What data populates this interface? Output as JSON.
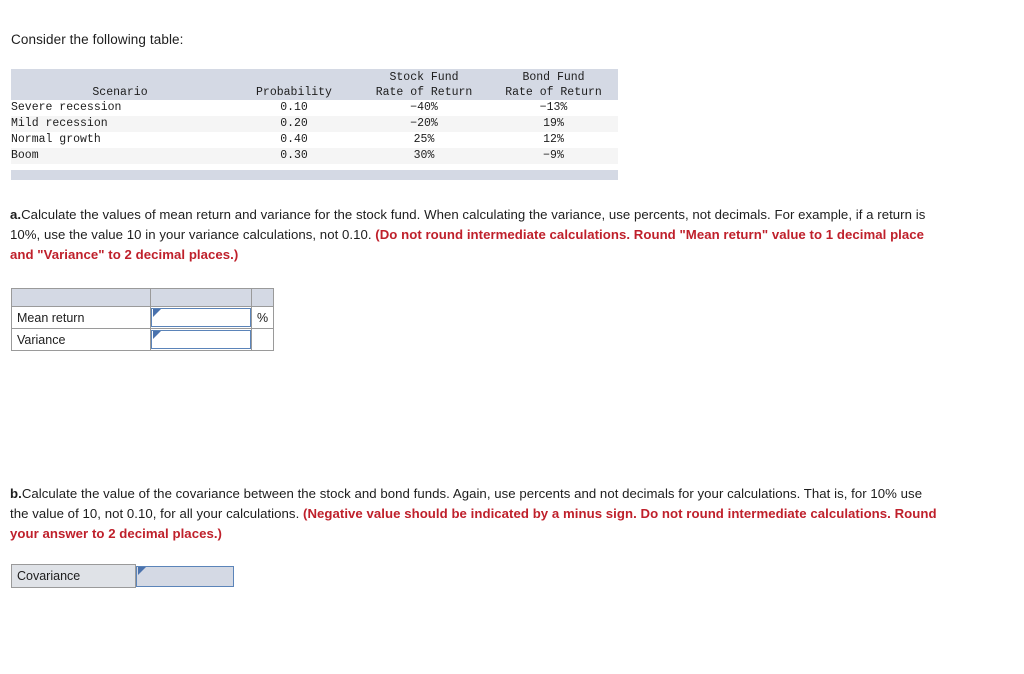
{
  "intro": "Consider the following table:",
  "scenario_table": {
    "headers": [
      {
        "line1": "",
        "line2": "Scenario"
      },
      {
        "line1": "",
        "line2": "Probability"
      },
      {
        "line1": "Stock Fund",
        "line2": "Rate of Return"
      },
      {
        "line1": "Bond Fund",
        "line2": "Rate of Return"
      }
    ],
    "rows": [
      {
        "scenario": "Severe recession",
        "probability": "0.10",
        "stock": "−40%",
        "bond": "−13%"
      },
      {
        "scenario": "Mild recession",
        "probability": "0.20",
        "stock": "−20%",
        "bond": "19%"
      },
      {
        "scenario": "Normal growth",
        "probability": "0.40",
        "stock": "25%",
        "bond": "12%"
      },
      {
        "scenario": "Boom",
        "probability": "0.30",
        "stock": "30%",
        "bond": "−9%"
      }
    ]
  },
  "question_a": {
    "label": "a.",
    "body": "Calculate the values of mean return and variance for the stock fund. When calculating the variance, use percents, not decimals.  For example, if a return is 10%, use the value 10 in your variance calculations, not 0.10. ",
    "emphasis": "(Do not round intermediate calculations. Round \"Mean return\" value to 1 decimal place and \"Variance\" to 2 decimal places.)"
  },
  "answer_a": {
    "rows": [
      {
        "label": "Mean return",
        "value": "",
        "placeholder": "",
        "unit": "%"
      },
      {
        "label": "Variance",
        "value": "",
        "placeholder": "",
        "unit": ""
      }
    ]
  },
  "question_b": {
    "label": "b.",
    "body": "Calculate the value of the covariance between the stock and bond funds.  Again, use percents and not decimals for your calculations.  That is, for 10% use the value of 10, not 0.10, for all your calculations. ",
    "emphasis": "(Negative value should be indicated by a minus sign. Do not round intermediate calculations. Round your answer to 2 decimal places.)"
  },
  "answer_b": {
    "label": "Covariance",
    "value": "",
    "placeholder": ""
  },
  "colors": {
    "header_fill": "#d4d9e4",
    "row_alt_fill": "#f5f5f5",
    "emphasis_red": "#bf202b",
    "field_border": "#5b84b9",
    "marker_blue": "#4a72ad"
  }
}
